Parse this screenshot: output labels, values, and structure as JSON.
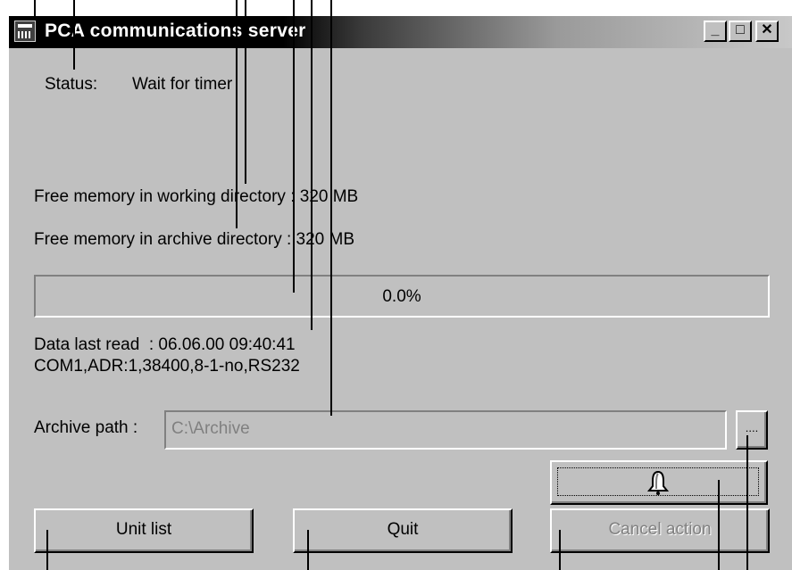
{
  "window": {
    "title": "PCA communications server",
    "controls": {
      "minimize": "_",
      "maximize": "□",
      "close": "✕"
    }
  },
  "status": {
    "label": "Status:",
    "value": "Wait for timer"
  },
  "memory": {
    "working": "Free memory in working directory : 320 MB",
    "archive": "Free memory in archive directory : 320 MB"
  },
  "progress": {
    "value": 0.0,
    "text": "0.0%"
  },
  "info": {
    "last_read": "Data last read  : 06.06.00 09:40:41",
    "connection": "COM1,ADR:1,38400,8-1-no,RS232"
  },
  "archive": {
    "label": "Archive path :",
    "value": "C:\\Archive",
    "browse_label": "...."
  },
  "buttons": {
    "unit_list": "Unit list",
    "quit": "Quit",
    "cancel": "Cancel action",
    "alarm_icon": "bell-icon"
  }
}
